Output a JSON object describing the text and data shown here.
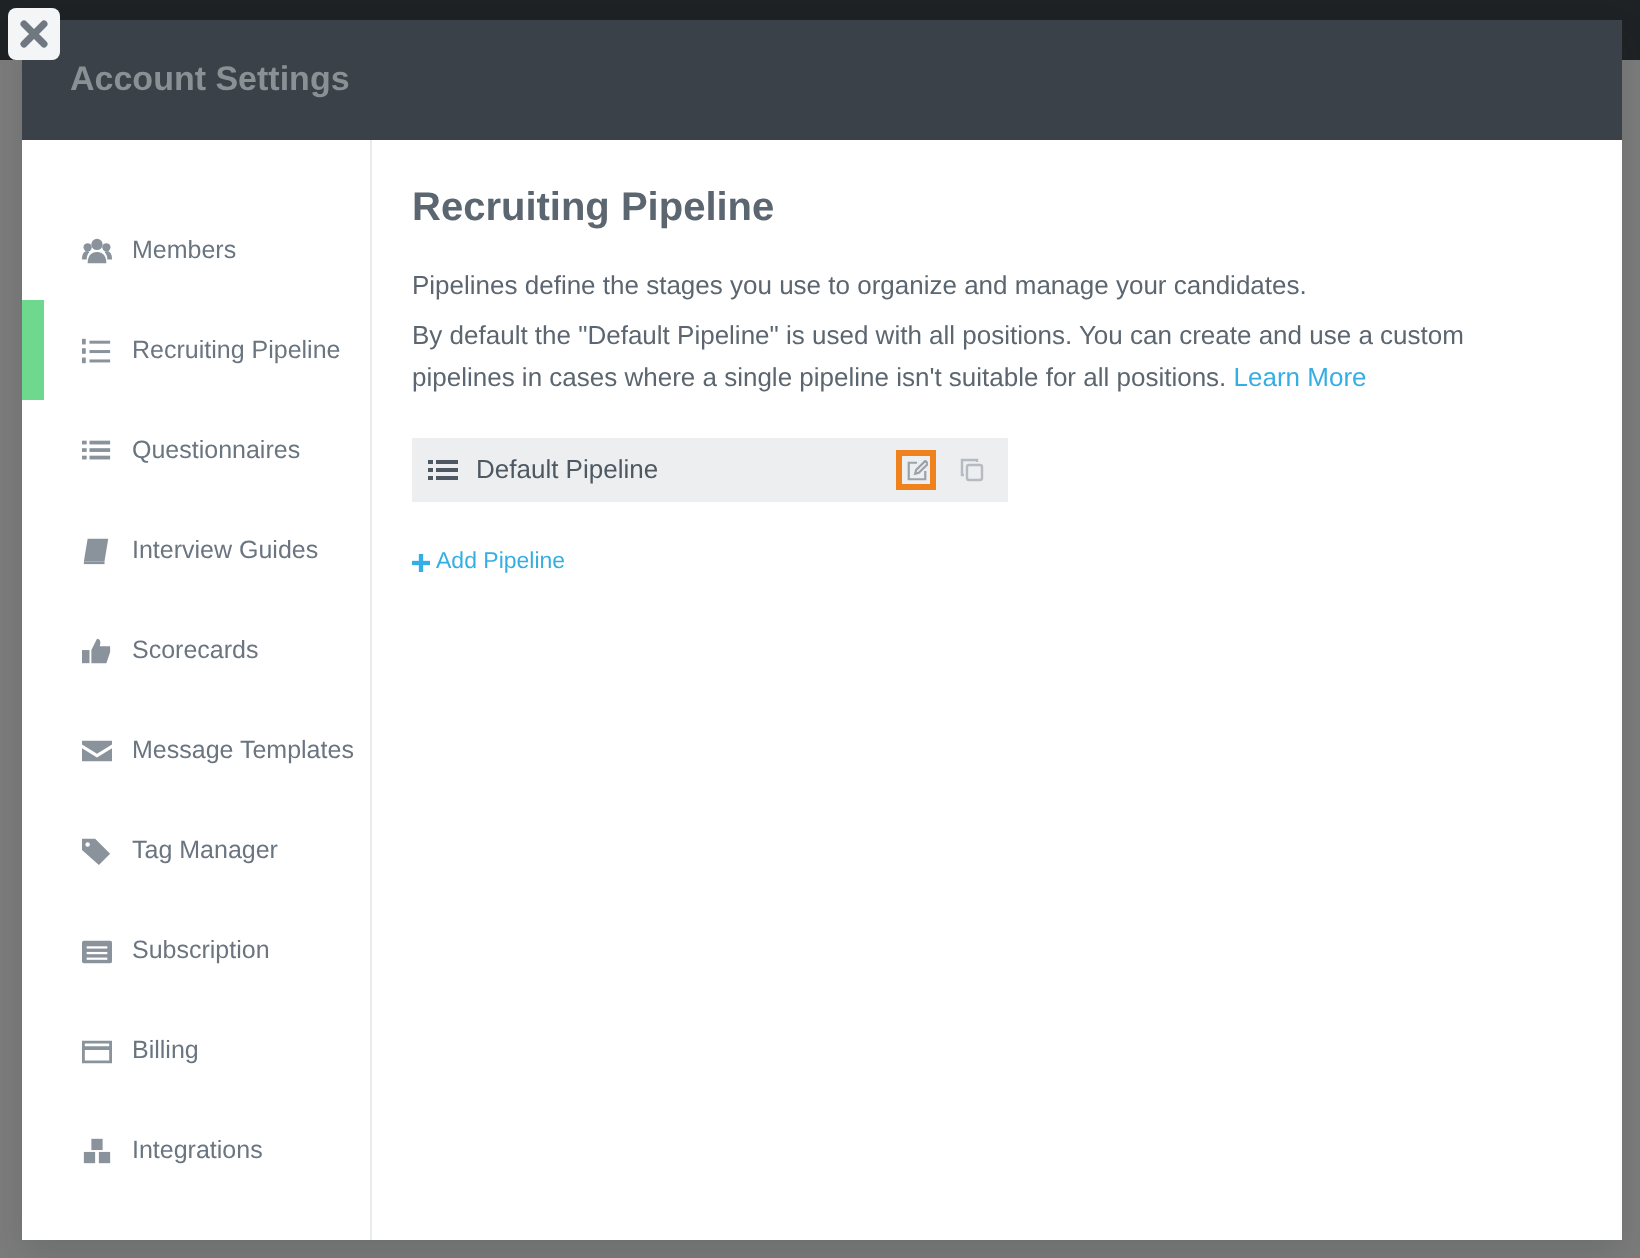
{
  "modal": {
    "title": "Account Settings"
  },
  "sidebar": {
    "items": [
      {
        "label": "Members",
        "selected": false
      },
      {
        "label": "Recruiting Pipeline",
        "selected": true
      },
      {
        "label": "Questionnaires",
        "selected": false
      },
      {
        "label": "Interview Guides",
        "selected": false
      },
      {
        "label": "Scorecards",
        "selected": false
      },
      {
        "label": "Message Templates",
        "selected": false
      },
      {
        "label": "Tag Manager",
        "selected": false
      },
      {
        "label": "Subscription",
        "selected": false
      },
      {
        "label": "Billing",
        "selected": false
      },
      {
        "label": "Integrations",
        "selected": false
      }
    ]
  },
  "content": {
    "heading": "Recruiting Pipeline",
    "intro": "Pipelines define the stages you use to organize and manage your candidates.",
    "description": "By default the \"Default Pipeline\" is used with all positions. You can create and use a custom pipelines in cases where a single pipeline isn't suitable for all positions.",
    "learn_more": "Learn More",
    "pipelines": [
      {
        "name": "Default Pipeline",
        "edit_highlighted": true
      }
    ],
    "add_label": "Add Pipeline"
  }
}
